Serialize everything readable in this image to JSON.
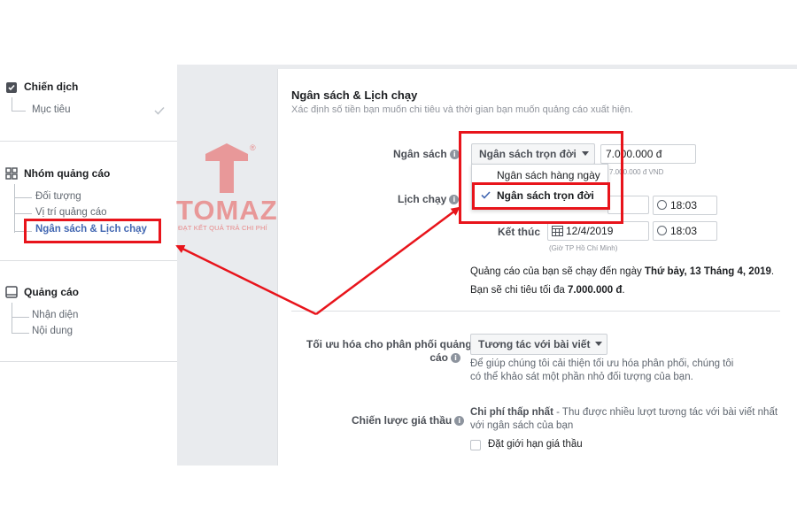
{
  "sidebar": {
    "campaign": {
      "title": "Chiến dịch",
      "items": [
        {
          "label": "Mục tiêu"
        }
      ]
    },
    "adset": {
      "title": "Nhóm quảng cáo",
      "items": [
        {
          "label": "Đối tượng"
        },
        {
          "label": "Vị trí quảng cáo"
        },
        {
          "label": "Ngân sách & Lịch chạy"
        }
      ]
    },
    "ad": {
      "title": "Quảng cáo",
      "items": [
        {
          "label": "Nhận diện"
        },
        {
          "label": "Nội dung"
        }
      ]
    }
  },
  "watermark": {
    "brand": "TOMAZ",
    "tagline": "ĐẠT KẾT QUẢ TRẢ CHI PHÍ",
    "reg": "®"
  },
  "main": {
    "title": "Ngân sách & Lịch chạy",
    "subtitle": "Xác định số tiền bạn muốn chi tiêu và thời gian bạn muốn quảng cáo xuất hiện.",
    "budget": {
      "label": "Ngân sách",
      "selected": "Ngân sách trọn đời",
      "amount": "7.000.000 đ",
      "amount_note": "7.000.000 đ VND",
      "options": [
        "Ngân sách hàng ngày",
        "Ngân sách trọn đời"
      ]
    },
    "schedule": {
      "label": "Lịch chạy",
      "start_time": "18:03",
      "end_label": "Kết thúc",
      "end_date": "12/4/2019",
      "end_time": "18:03",
      "timezone": "(Giờ TP Hồ Chí Minh)",
      "summary_prefix": "Quảng cáo của bạn sẽ chạy đến ngày ",
      "summary_date": "Thứ bảy, 13 Tháng 4, 2019",
      "summary_suffix": ".",
      "spend_prefix": "Bạn sẽ chi tiêu tối đa ",
      "spend_amount": "7.000.000 đ",
      "spend_suffix": "."
    },
    "optimization": {
      "label_line1": "Tối ưu hóa cho phân phối quảng",
      "label_line2": "cáo",
      "selected": "Tương tác với bài viết",
      "help_line1": "Để giúp chúng tôi cải thiện tối ưu hóa phân phối, chúng tôi",
      "help_line2": "có thể khảo sát một phần nhỏ đối tượng của bạn."
    },
    "bid": {
      "label": "Chiến lược giá thầu",
      "strategy": "Chi phí thấp nhất",
      "desc_line1": " - Thu được nhiều lượt tương tác với bài viết nhất",
      "desc_line2": "với ngân sách của bạn",
      "cap_label": "Đặt giới hạn giá thầu"
    }
  },
  "colors": {
    "highlight": "#e8141b",
    "link": "#4267b2",
    "sidebar_active": "#4267b2"
  },
  "icons": [
    "checkbox-icon",
    "adset-grid-icon",
    "ad-box-icon",
    "check-mark-icon",
    "info-icon",
    "calendar-icon",
    "clock-icon",
    "caret-down-icon",
    "tomaz-logo-icon"
  ]
}
